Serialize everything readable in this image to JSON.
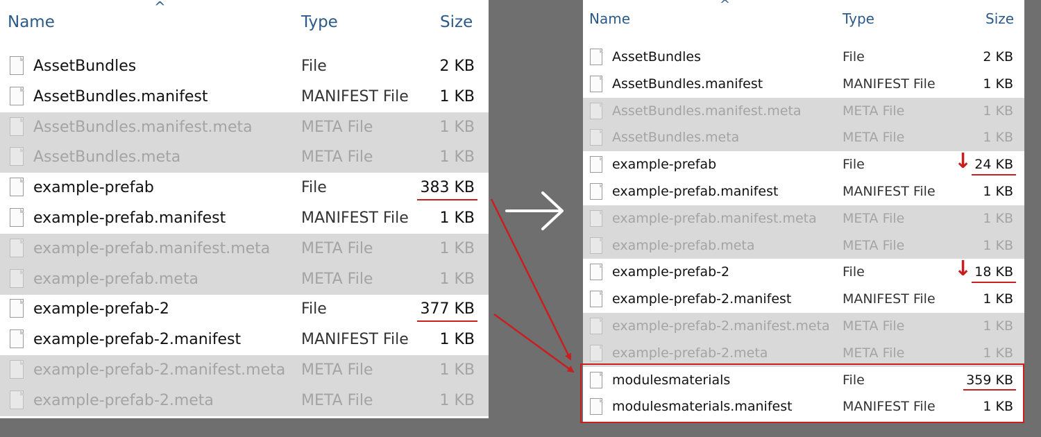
{
  "left": {
    "headers": {
      "name": "Name",
      "type": "Type",
      "size": "Size"
    },
    "sort_indicator": "^",
    "rows": [
      {
        "name": "AssetBundles",
        "type": "File",
        "size": "2 KB",
        "meta": false
      },
      {
        "name": "AssetBundles.manifest",
        "type": "MANIFEST File",
        "size": "1 KB",
        "meta": false
      },
      {
        "name": "AssetBundles.manifest.meta",
        "type": "META File",
        "size": "1 KB",
        "meta": true
      },
      {
        "name": "AssetBundles.meta",
        "type": "META File",
        "size": "1 KB",
        "meta": true
      },
      {
        "name": "example-prefab",
        "type": "File",
        "size": "383 KB",
        "meta": false,
        "underline": true
      },
      {
        "name": "example-prefab.manifest",
        "type": "MANIFEST File",
        "size": "1 KB",
        "meta": false
      },
      {
        "name": "example-prefab.manifest.meta",
        "type": "META File",
        "size": "1 KB",
        "meta": true
      },
      {
        "name": "example-prefab.meta",
        "type": "META File",
        "size": "1 KB",
        "meta": true
      },
      {
        "name": "example-prefab-2",
        "type": "File",
        "size": "377 KB",
        "meta": false,
        "underline": true
      },
      {
        "name": "example-prefab-2.manifest",
        "type": "MANIFEST File",
        "size": "1 KB",
        "meta": false
      },
      {
        "name": "example-prefab-2.manifest.meta",
        "type": "META File",
        "size": "1 KB",
        "meta": true
      },
      {
        "name": "example-prefab-2.meta",
        "type": "META File",
        "size": "1 KB",
        "meta": true
      }
    ]
  },
  "right": {
    "headers": {
      "name": "Name",
      "type": "Type",
      "size": "Size"
    },
    "sort_indicator": "^",
    "rows": [
      {
        "name": "AssetBundles",
        "type": "File",
        "size": "2 KB",
        "meta": false
      },
      {
        "name": "AssetBundles.manifest",
        "type": "MANIFEST File",
        "size": "1 KB",
        "meta": false
      },
      {
        "name": "AssetBundles.manifest.meta",
        "type": "META File",
        "size": "1 KB",
        "meta": true
      },
      {
        "name": "AssetBundles.meta",
        "type": "META File",
        "size": "1 KB",
        "meta": true
      },
      {
        "name": "example-prefab",
        "type": "File",
        "size": "24 KB",
        "meta": false,
        "underline": true,
        "down_arrow": true
      },
      {
        "name": "example-prefab.manifest",
        "type": "MANIFEST File",
        "size": "1 KB",
        "meta": false
      },
      {
        "name": "example-prefab.manifest.meta",
        "type": "META File",
        "size": "1 KB",
        "meta": true
      },
      {
        "name": "example-prefab.meta",
        "type": "META File",
        "size": "1 KB",
        "meta": true
      },
      {
        "name": "example-prefab-2",
        "type": "File",
        "size": "18 KB",
        "meta": false,
        "underline": true,
        "down_arrow": true
      },
      {
        "name": "example-prefab-2.manifest",
        "type": "MANIFEST File",
        "size": "1 KB",
        "meta": false
      },
      {
        "name": "example-prefab-2.manifest.meta",
        "type": "META File",
        "size": "1 KB",
        "meta": true
      },
      {
        "name": "example-prefab-2.meta",
        "type": "META File",
        "size": "1 KB",
        "meta": true
      },
      {
        "name": "modulesmaterials",
        "type": "File",
        "size": "359 KB",
        "meta": false,
        "underline": true
      },
      {
        "name": "modulesmaterials.manifest",
        "type": "MANIFEST File",
        "size": "1 KB",
        "meta": false
      }
    ]
  },
  "colors": {
    "annotation_red": "#c81e1e",
    "header_blue": "#2b5a8a",
    "meta_row_bg": "#d9d9d9",
    "background": "#6f6f6f"
  },
  "icons": {
    "file": "file-icon",
    "transition_arrow": "arrow-right-icon",
    "decrease": "arrow-down-icon"
  }
}
